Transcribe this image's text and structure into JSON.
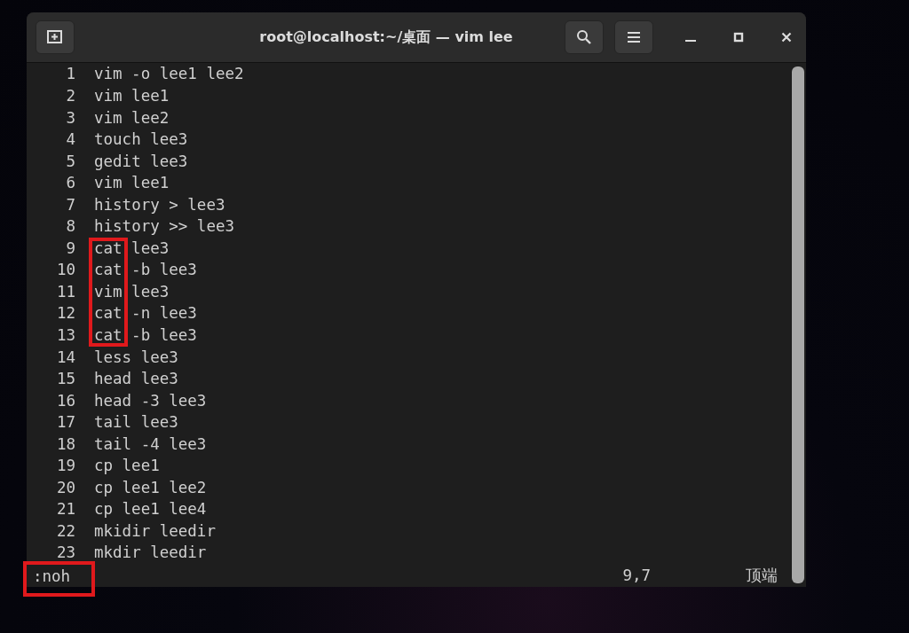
{
  "window": {
    "title": "root@localhost:~/桌面 — vim lee"
  },
  "lines": [
    {
      "number": "1",
      "command": "vim",
      "args": "-o lee1 lee2",
      "boxed": false
    },
    {
      "number": "2",
      "command": "vim",
      "args": "lee1",
      "boxed": false
    },
    {
      "number": "3",
      "command": "vim",
      "args": "lee2",
      "boxed": false
    },
    {
      "number": "4",
      "command": "touch",
      "args": "lee3",
      "boxed": false
    },
    {
      "number": "5",
      "command": "gedit",
      "args": "lee3",
      "boxed": false
    },
    {
      "number": "6",
      "command": "vim",
      "args": "lee1",
      "boxed": false
    },
    {
      "number": "7",
      "command": "history",
      "args": "> lee3",
      "boxed": false
    },
    {
      "number": "8",
      "command": "history",
      "args": ">> lee3",
      "boxed": false
    },
    {
      "number": "9",
      "command": "cat",
      "args": "lee3",
      "boxed": true
    },
    {
      "number": "10",
      "command": "cat",
      "args": "-b lee3",
      "boxed": true
    },
    {
      "number": "11",
      "command": "vim",
      "args": "lee3",
      "boxed": true
    },
    {
      "number": "12",
      "command": "cat",
      "args": "-n lee3",
      "boxed": true
    },
    {
      "number": "13",
      "command": "cat",
      "args": "-b lee3",
      "boxed": true
    },
    {
      "number": "14",
      "command": "less",
      "args": "lee3",
      "boxed": false
    },
    {
      "number": "15",
      "command": "head",
      "args": "lee3",
      "boxed": false
    },
    {
      "number": "16",
      "command": "head",
      "args": "-3 lee3",
      "boxed": false
    },
    {
      "number": "17",
      "command": "tail",
      "args": "lee3",
      "boxed": false
    },
    {
      "number": "18",
      "command": "tail",
      "args": "-4 lee3",
      "boxed": false
    },
    {
      "number": "19",
      "command": "cp",
      "args": "lee1",
      "boxed": false
    },
    {
      "number": "20",
      "command": "cp",
      "args": "lee1 lee2",
      "boxed": false
    },
    {
      "number": "21",
      "command": "cp",
      "args": "lee1 lee4",
      "boxed": false
    },
    {
      "number": "22",
      "command": "mkidir",
      "args": "leedir",
      "boxed": false
    },
    {
      "number": "23",
      "command": "mkdir",
      "args": "leedir",
      "boxed": false
    }
  ],
  "status_line": {
    "command": ":noh",
    "command_boxed": true,
    "cursor": "9,7",
    "position": "顶端"
  }
}
